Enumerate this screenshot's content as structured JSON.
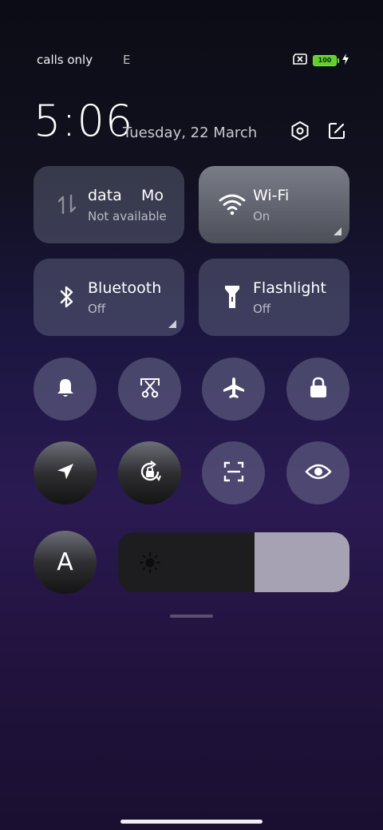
{
  "status": {
    "carrier": "calls only",
    "extra": "E",
    "battery": "100"
  },
  "header": {
    "time": "5:06",
    "date": "Tuesday, 22 March"
  },
  "tiles": {
    "data": {
      "title": "data    Mo",
      "sub": "Not available"
    },
    "wifi": {
      "title": "Wi-Fi",
      "sub": "On"
    },
    "bluetooth": {
      "title": "Bluetooth",
      "sub": "Off"
    },
    "flashlight": {
      "title": "Flashlight",
      "sub": "Off"
    }
  },
  "brightness": {
    "level": 0.41
  },
  "auto_brightness": {
    "label": "A"
  },
  "colors": {
    "tile": "#5f6278",
    "tile_active": "#6a6c78",
    "round": "#6c6c8a",
    "brightness_fill": "#a7a2b3",
    "battery": "#61d02b"
  }
}
